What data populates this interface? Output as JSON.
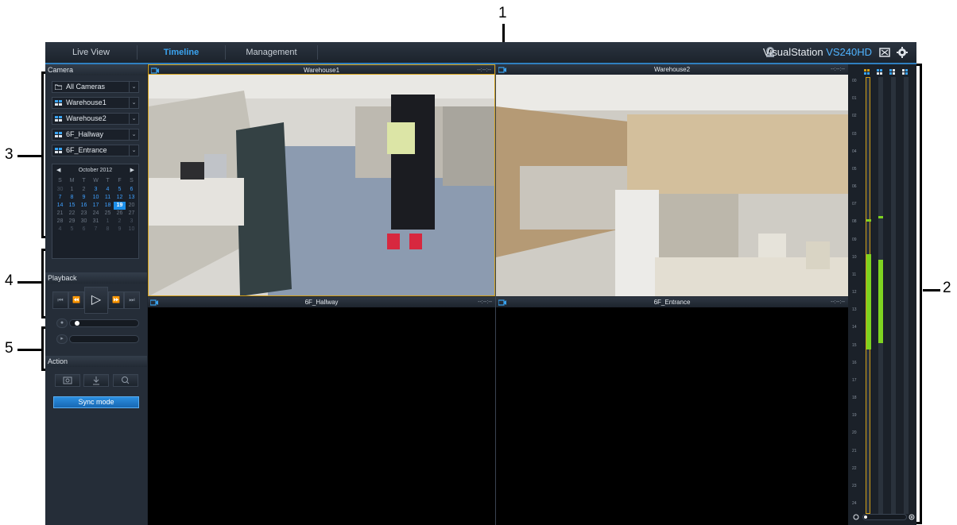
{
  "callouts": [
    "1",
    "2",
    "3",
    "4",
    "5"
  ],
  "app": {
    "tabs": [
      "Live View",
      "Timeline",
      "Management"
    ],
    "active_tab": "Timeline",
    "brand_name": "VisualStation",
    "brand_model": "VS240HD",
    "accent_color": "#3aa3f0"
  },
  "camera_panel": {
    "title": "Camera",
    "cameras": [
      {
        "label": "All Cameras",
        "icon": "folder-icon"
      },
      {
        "label": "Warehouse1",
        "icon": "camera-grid-icon"
      },
      {
        "label": "Warehouse2",
        "icon": "camera-grid-icon"
      },
      {
        "label": "6F_Hallway",
        "icon": "camera-grid-icon"
      },
      {
        "label": "6F_Entrance",
        "icon": "camera-grid-icon"
      }
    ]
  },
  "calendar": {
    "month": "October 2012",
    "weekdays": [
      "S",
      "M",
      "T",
      "W",
      "T",
      "F",
      "S"
    ],
    "selected": "19",
    "weeks": [
      [
        "30",
        "1",
        "2",
        "3",
        "4",
        "5",
        "6"
      ],
      [
        "7",
        "8",
        "9",
        "10",
        "11",
        "12",
        "13"
      ],
      [
        "14",
        "15",
        "16",
        "17",
        "18",
        "19",
        "20"
      ],
      [
        "21",
        "22",
        "23",
        "24",
        "25",
        "26",
        "27"
      ],
      [
        "28",
        "29",
        "30",
        "31",
        "1",
        "2",
        "3"
      ],
      [
        "4",
        "5",
        "6",
        "7",
        "8",
        "9",
        "10"
      ]
    ]
  },
  "playback": {
    "title": "Playback",
    "speed": 0.05
  },
  "action": {
    "title": "Action",
    "sync_label": "Sync mode"
  },
  "videos": [
    {
      "name": "Warehouse1",
      "time": "--:--:--"
    },
    {
      "name": "Warehouse2",
      "time": "--:--:--"
    },
    {
      "name": "6F_Hallway",
      "time": "--:--:--"
    },
    {
      "name": "6F_Entrance",
      "time": "--:--:--"
    }
  ],
  "timeline": {
    "hours": [
      "00",
      "01",
      "02",
      "03",
      "04",
      "05",
      "06",
      "07",
      "08",
      "09",
      "10",
      "11",
      "12",
      "13",
      "14",
      "15",
      "16",
      "17",
      "18",
      "19",
      "20",
      "21",
      "22",
      "23",
      "24"
    ]
  }
}
